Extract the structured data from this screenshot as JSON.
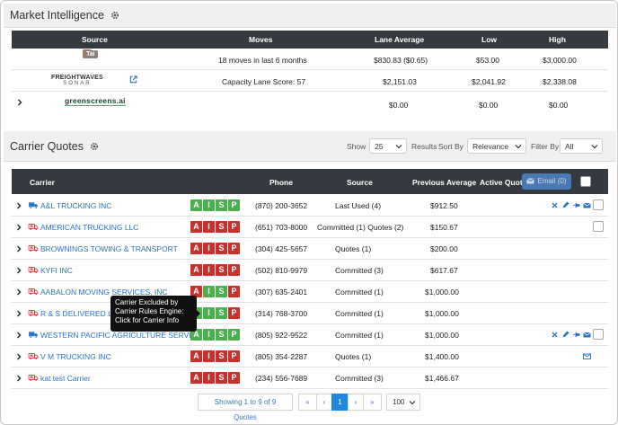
{
  "market_intelligence": {
    "title": "Market Intelligence",
    "columns": [
      "Source",
      "Moves",
      "Lane Average",
      "Low",
      "High"
    ],
    "rows": [
      {
        "source": "Tai",
        "moves": "18 moves in last 6 months",
        "lane_average": "$830.83 ($0.65)",
        "low": "$53.00",
        "high": "$3,000.00"
      },
      {
        "source": "FREIGHTWAVES SONAR",
        "source_top": "FREIGHTWAVES",
        "source_bottom": "SONAR",
        "moves": "Capacity Lane Score: 57",
        "lane_average": "$2,151.03",
        "low": "$2,041.92",
        "high": "$2,338.08"
      },
      {
        "source": "greenscreens.ai",
        "moves": "",
        "lane_average": "$0.00",
        "low": "$0.00",
        "high": "$0.00"
      }
    ]
  },
  "carrier_quotes": {
    "title": "Carrier Quotes",
    "controls": {
      "show_label": "Show",
      "show_value": "25",
      "results_label": "Results",
      "sort_label": "Sort By",
      "sort_value": "Relevance",
      "filter_label": "Filter By",
      "filter_value": "All"
    },
    "columns": [
      "Carrier",
      "Phone",
      "Source",
      "Previous Average",
      "Active Quote"
    ],
    "email_button": "Email (0)",
    "aisp_letters": [
      "A",
      "I",
      "S",
      "P"
    ],
    "rows": [
      {
        "carrier": "A&L TRUCKING INC",
        "phone": "(870) 200-3652",
        "source": "Last Used (4)",
        "prev_avg": "$912.50",
        "aisp": [
          "g",
          "g",
          "g",
          "g"
        ],
        "truck": "blue",
        "actions": true
      },
      {
        "carrier": "AMERICAN TRUCKING LLC",
        "phone": "(651) 703-8000",
        "source": "Committed (1) Quotes (2)",
        "prev_avg": "$150.67",
        "aisp": [
          "r",
          "r",
          "r",
          "r"
        ],
        "truck": "red",
        "actions": false
      },
      {
        "carrier": "BROWNINGS TOWING & TRANSPORT",
        "phone": "(304) 425-5657",
        "source": "Quotes (1)",
        "prev_avg": "$200.00",
        "aisp": [
          "r",
          "r",
          "r",
          "r"
        ],
        "truck": "red",
        "actions": false
      },
      {
        "carrier": "KYFI INC",
        "phone": "(502) 810-9979",
        "source": "Committed (3)",
        "prev_avg": "$617.67",
        "aisp": [
          "r",
          "r",
          "r",
          "r"
        ],
        "truck": "red",
        "actions": false
      },
      {
        "carrier": "AABALON MOVING SERVICES, INC",
        "phone": "(307) 635-2401",
        "source": "Committed (1)",
        "prev_avg": "$1,000.00",
        "aisp": [
          "r",
          "g",
          "g",
          "r"
        ],
        "truck": "red",
        "actions": false
      },
      {
        "carrier": "R & S DELIVERED LLC",
        "phone": "(314) 768-3700",
        "source": "Committed (1)",
        "prev_avg": "$1,000.00",
        "aisp": [
          "g",
          "g",
          "g",
          "r"
        ],
        "truck": "red",
        "actions": false
      },
      {
        "carrier": "WESTERN PACIFIC AGRICULTURE SERVICE",
        "phone": "(805) 922-9522",
        "source": "Committed (1)",
        "prev_avg": "$1,000.00",
        "aisp": [
          "g",
          "g",
          "g",
          "g"
        ],
        "truck": "blue",
        "actions": true
      },
      {
        "carrier": "V M TRUCKING INC",
        "phone": "(805) 354-2287",
        "source": "Quotes (1)",
        "prev_avg": "$1,400.00",
        "aisp": [
          "r",
          "r",
          "r",
          "r"
        ],
        "truck": "red",
        "actions": false
      },
      {
        "carrier": "kat test Carrier",
        "phone": "(234) 556-7689",
        "source": "Committed (3)",
        "prev_avg": "$1,466.67",
        "aisp": [
          "r",
          "r",
          "r",
          "r"
        ],
        "truck": "red",
        "actions": false
      }
    ],
    "tooltip": "Carrier Excluded by Carrier Rules Engine: Click for Carrier Info",
    "pagination": {
      "info": "Showing 1 to 9 of 9 Quotes",
      "first": "«",
      "prev": "‹",
      "current": "1",
      "next": "›",
      "last": "»",
      "per_page": "100"
    }
  },
  "colors": {
    "header_bg": "#343a40",
    "link": "#2b74c6",
    "aisp_green": "#4caf50",
    "aisp_red": "#c8302e",
    "email_button": "#4a78b2"
  },
  "icons": [
    "gear-icon",
    "external-link-icon",
    "chevron-right-icon",
    "truck-icon",
    "truck-excluded-icon",
    "close-icon",
    "edit-icon",
    "pin-icon",
    "envelope-icon",
    "caret-down-icon"
  ]
}
